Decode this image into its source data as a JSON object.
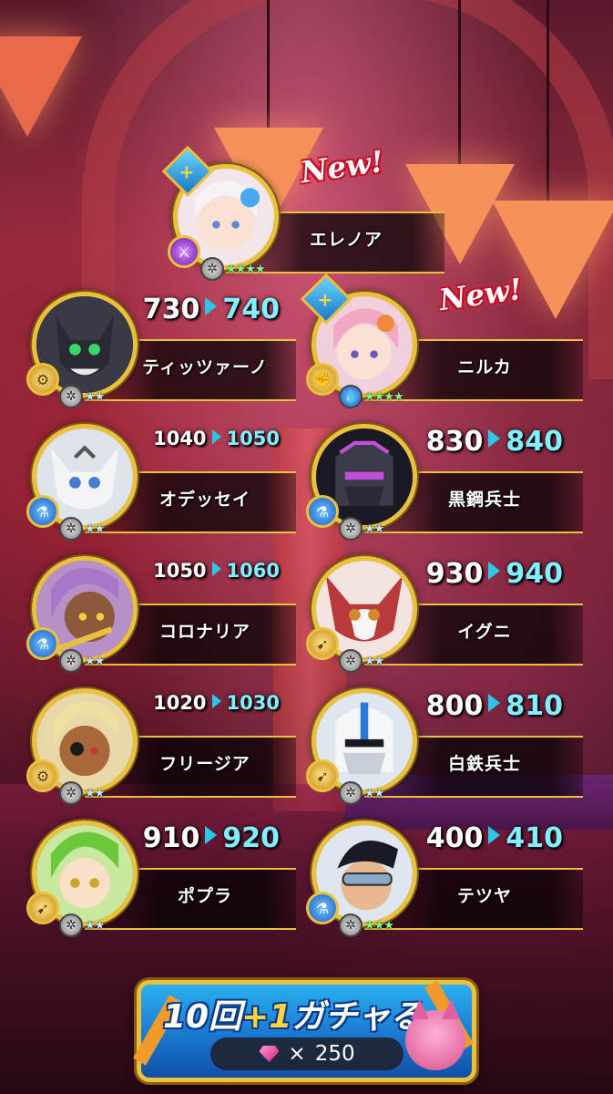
{
  "characters": [
    {
      "id": "eleanor",
      "name": "エレノア",
      "new_badge": "New!",
      "level_from": "",
      "level_to": "",
      "rarity": "★★★★",
      "portrait": "white-hair-girl"
    },
    {
      "id": "tizziano",
      "name": "ティッツァーノ",
      "level_from": "730",
      "level_to": "740",
      "rarity": "★★",
      "portrait": "black-cat"
    },
    {
      "id": "nirka",
      "name": "ニルカ",
      "new_badge": "New!",
      "level_from": "",
      "level_to": "",
      "rarity": "★★★★",
      "portrait": "pink-hair-girl"
    },
    {
      "id": "odessei",
      "name": "オデッセイ",
      "level_from": "1040",
      "level_to": "1050",
      "rarity": "★★",
      "portrait": "white-cat"
    },
    {
      "id": "kokko",
      "name": "黒鋼兵士",
      "level_from": "830",
      "level_to": "840",
      "rarity": "★★",
      "portrait": "black-armor"
    },
    {
      "id": "coronaria",
      "name": "コロナリア",
      "level_from": "1050",
      "level_to": "1060",
      "rarity": "★★",
      "portrait": "purple-hair-elf"
    },
    {
      "id": "iguni",
      "name": "イグニ",
      "level_from": "930",
      "level_to": "940",
      "rarity": "★★",
      "portrait": "red-cat"
    },
    {
      "id": "freesia",
      "name": "フリージア",
      "level_from": "1020",
      "level_to": "1030",
      "rarity": "★★",
      "portrait": "blonde-elf"
    },
    {
      "id": "hakutetsu",
      "name": "白鉄兵士",
      "level_from": "800",
      "level_to": "810",
      "rarity": "★★",
      "portrait": "white-armor"
    },
    {
      "id": "popura",
      "name": "ポプラ",
      "level_from": "910",
      "level_to": "920",
      "rarity": "★★",
      "portrait": "green-hair-girl"
    },
    {
      "id": "tetsuya",
      "name": "テツヤ",
      "level_from": "400",
      "level_to": "410",
      "rarity": "★★★",
      "portrait": "goggles-man"
    }
  ],
  "gacha_button": {
    "title_count": "10回",
    "title_plus": "+1",
    "title_action": "ガチャる",
    "cost_multiplier": "×",
    "cost_value": "250"
  },
  "colors": {
    "accent_gold": "#e9c13c",
    "level_new": "#7ff0ff",
    "new_tag_red": "#c0102a"
  }
}
